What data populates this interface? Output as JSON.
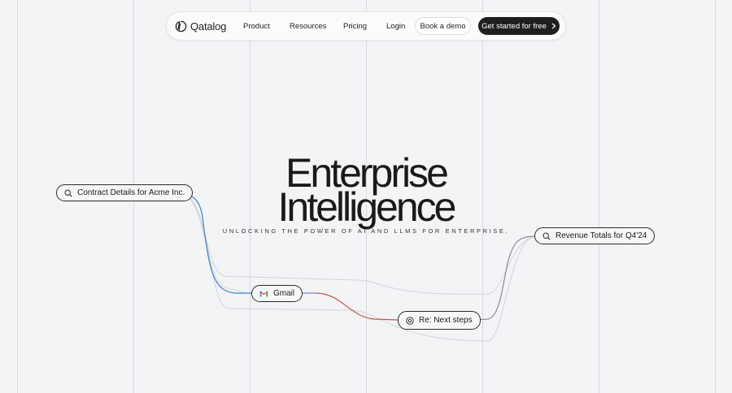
{
  "nav": {
    "logo_text": "Qatalog",
    "links": [
      "Product",
      "Resources",
      "Pricing",
      "Login"
    ],
    "demo_label": "Book a demo",
    "cta_label": "Get started for free"
  },
  "hero": {
    "title_line1": "Enterprise",
    "title_line2": "Intelligence",
    "subtitle": "UNLOCKING THE POWER OF AI AND LLMS FOR ENTERPRISE."
  },
  "chips": {
    "contract": "Contract Details for Acme Inc.",
    "gmail": "Gmail",
    "reply": "Re: Next steps",
    "revenue": "Revenue Totals for Q4'24"
  },
  "colors": {
    "background": "#f3f4f6",
    "blue_line": "#3b7fd4",
    "purple_line": "#8a7bd1",
    "red_line": "#c9554f"
  },
  "icons": [
    "logo-icon",
    "chevron-right-icon",
    "search-icon",
    "gmail-icon",
    "at-icon"
  ]
}
